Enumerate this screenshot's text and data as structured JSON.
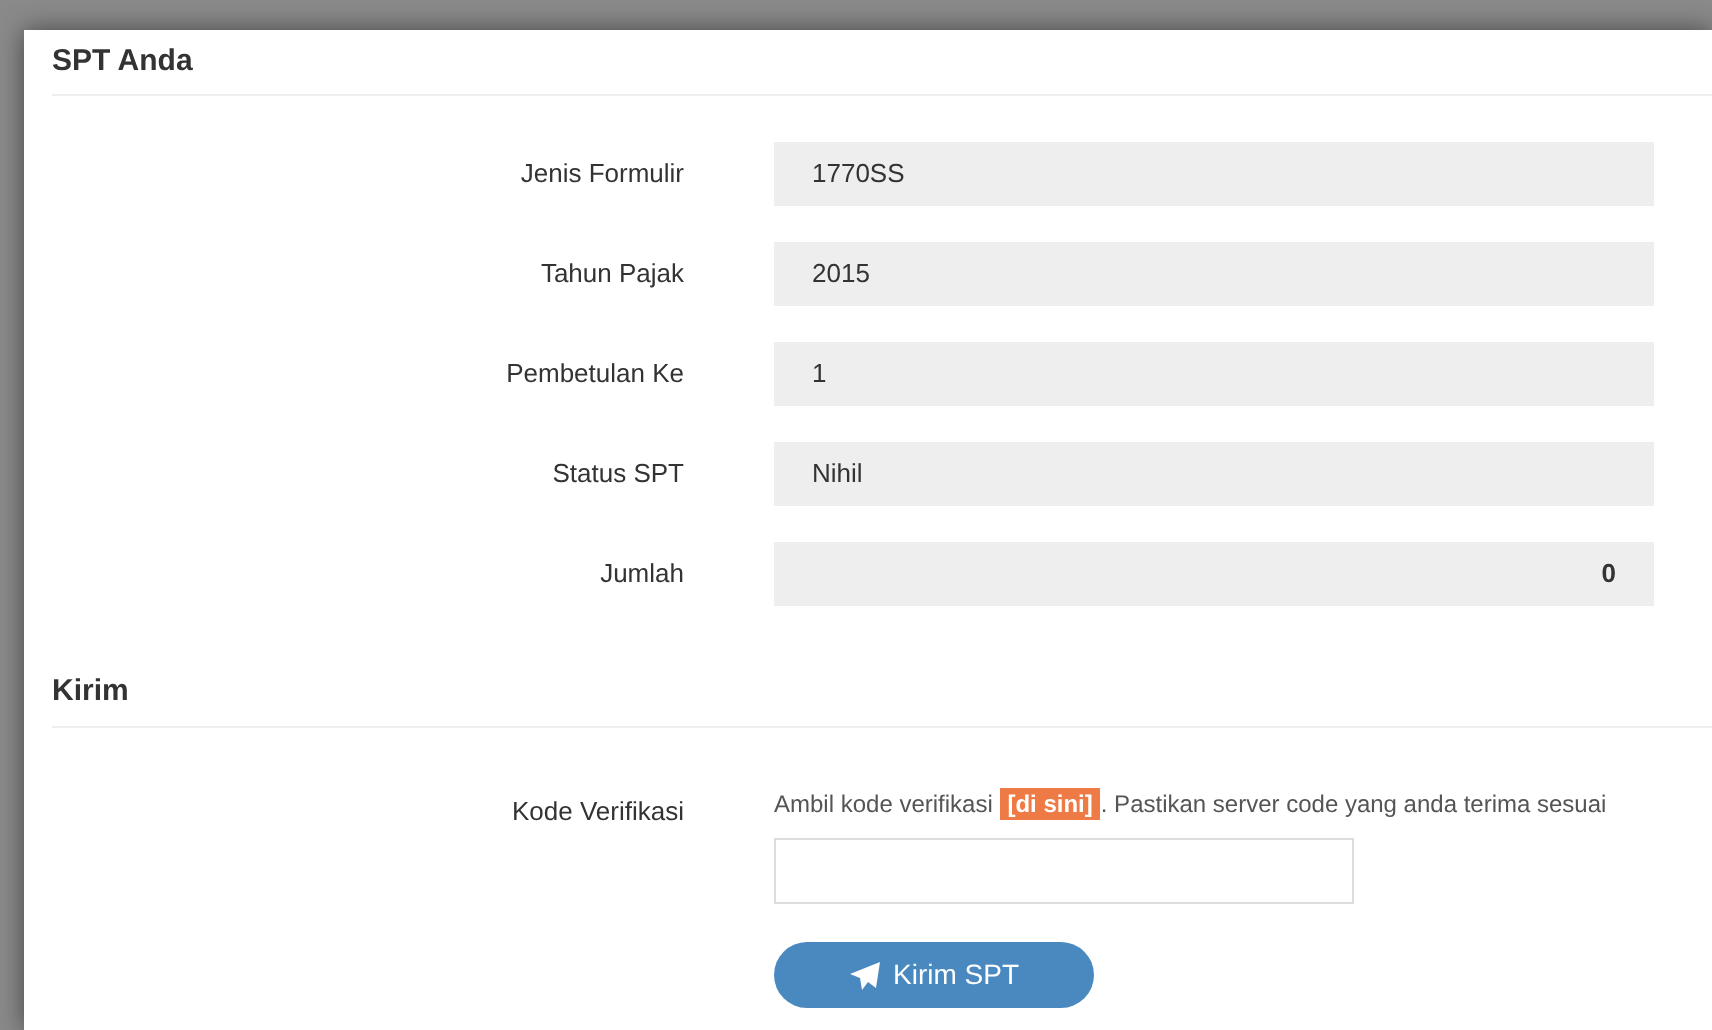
{
  "spt_section": {
    "title": "SPT Anda",
    "fields": [
      {
        "label": "Jenis Formulir",
        "value": "1770SS",
        "kind": "text"
      },
      {
        "label": "Tahun Pajak",
        "value": "2015",
        "kind": "text"
      },
      {
        "label": "Pembetulan Ke",
        "value": "1",
        "kind": "text"
      },
      {
        "label": "Status SPT",
        "value": "Nihil",
        "kind": "text"
      },
      {
        "label": "Jumlah",
        "value": "0",
        "kind": "amount"
      }
    ]
  },
  "send_section": {
    "title": "Kirim",
    "verification": {
      "label": "Kode Verifikasi",
      "help_before": "Ambil kode verifikasi",
      "help_link": "[di sini]",
      "help_after": ". Pastikan server code yang anda terima sesuai"
    },
    "submit_button": "Kirim SPT"
  }
}
